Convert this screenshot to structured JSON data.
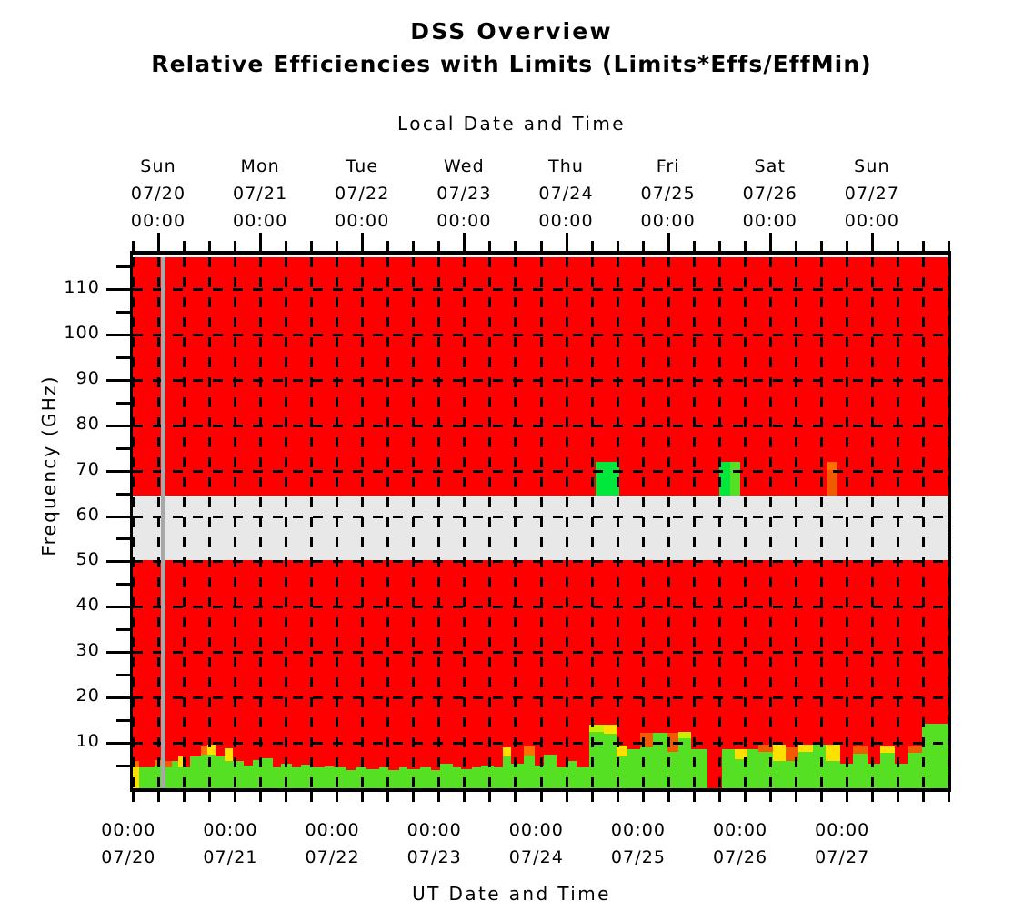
{
  "title": {
    "main": "DSS Overview",
    "sub": "Relative Efficiencies with Limits (Limits*Effs/EffMin)"
  },
  "axes": {
    "top_title": "Local Date and Time",
    "bottom_title": "UT Date and Time",
    "y_title": "Frequency (GHz)"
  },
  "chart_data": {
    "type": "heatmap",
    "title": "DSS Overview — Relative Efficiencies with Limits (Limits*Effs/EffMin)",
    "xlabel": "Local Date and Time",
    "xlabel_secondary": "UT Date and Time",
    "ylabel": "Frequency (GHz)",
    "ylim": [
      0,
      117
    ],
    "ytick_major": [
      10,
      20,
      30,
      40,
      50,
      60,
      70,
      80,
      90,
      100,
      110
    ],
    "ytick_minor_step": 5,
    "grid": "dashed black, horizontal every 10 GHz, vertical every 6 hours",
    "xlim_days": 8,
    "x_minor_step_hours": 6,
    "top_ticks": [
      {
        "weekday": "Sun",
        "date": "07/20",
        "time": "00:00"
      },
      {
        "weekday": "Mon",
        "date": "07/21",
        "time": "00:00"
      },
      {
        "weekday": "Tue",
        "date": "07/22",
        "time": "00:00"
      },
      {
        "weekday": "Wed",
        "date": "07/23",
        "time": "00:00"
      },
      {
        "weekday": "Thu",
        "date": "07/24",
        "time": "00:00"
      },
      {
        "weekday": "Fri",
        "date": "07/25",
        "time": "00:00"
      },
      {
        "weekday": "Sat",
        "date": "07/26",
        "time": "00:00"
      },
      {
        "weekday": "Sun",
        "date": "07/27",
        "time": "00:00"
      }
    ],
    "bottom_ticks": [
      {
        "time": "00:00",
        "date": "07/20"
      },
      {
        "time": "00:00",
        "date": "07/21"
      },
      {
        "time": "00:00",
        "date": "07/22"
      },
      {
        "time": "00:00",
        "date": "07/23"
      },
      {
        "time": "00:00",
        "date": "07/24"
      },
      {
        "time": "00:00",
        "date": "07/25"
      },
      {
        "time": "00:00",
        "date": "07/26"
      },
      {
        "time": "00:00",
        "date": "07/27"
      }
    ],
    "colors": {
      "red": "#ff0000",
      "orange": "#ff7000",
      "dark_orange": "#f25a00",
      "yellow": "#ffe000",
      "yellow_green": "#c8f000",
      "green": "#55e024",
      "bright_green": "#00e83c",
      "masked_band": "#e8e8e8",
      "now_marker": "#a8a8a8",
      "background": "#ffffff",
      "axis": "#000000"
    },
    "masked_bands": [
      {
        "y_from": 50.2,
        "y_to": 64.6,
        "label": "opaque / no data band"
      }
    ],
    "now_marker": {
      "hours_from_start": 6.6,
      "label": "current time"
    },
    "blocks_upper": [
      {
        "x_hours_from_start": 109,
        "width_hours": 5.6,
        "y_from": 64.6,
        "y_to": 71.9,
        "color": "bright_green"
      },
      {
        "x_hours_from_start": 138,
        "width_hours": 4.8,
        "y_from": 64.6,
        "y_to": 71.9,
        "color": "bright_green"
      },
      {
        "x_hours_from_start": 140.6,
        "width_hours": 2.4,
        "y_from": 64.6,
        "y_to": 71.9,
        "color": "green"
      },
      {
        "x_hours_from_start": 163.5,
        "width_hours": 2.4,
        "y_from": 64.6,
        "y_to": 71.9,
        "color": "dark_orange"
      },
      {
        "x_hours_from_start": 163.5,
        "width_hours": 2.4,
        "y_from": 70.2,
        "y_to": 71.9,
        "color": "orange"
      }
    ],
    "lower_band_note": "Dense 1-hour resolution mosaic below ~14 GHz with green, yellow-green, yellow, orange and red cells; all area above is red except the masked 50-65 GHz band and three 65-72 GHz blocks.",
    "cells": [
      {
        "x": 0,
        "w": 7,
        "y0": 0.0,
        "y1": 4.6,
        "c": "yellow"
      },
      {
        "x": 0,
        "w": 7,
        "y0": 4.6,
        "y1": 6.0,
        "c": "orange"
      },
      {
        "x": 7,
        "w": 7,
        "y0": 0.0,
        "y1": 4.6,
        "c": "green"
      },
      {
        "x": 7,
        "w": 10,
        "y0": 4.6,
        "y1": 6.0,
        "c": "red"
      },
      {
        "x": 14,
        "w": 10,
        "y0": 0.0,
        "y1": 4.6,
        "c": "green"
      },
      {
        "x": 24,
        "w": 10,
        "y0": 0.0,
        "y1": 5.0,
        "c": "green"
      },
      {
        "x": 24,
        "w": 10,
        "y0": 5.0,
        "y1": 6.2,
        "c": "orange"
      },
      {
        "x": 34,
        "w": 9,
        "y0": 0.0,
        "y1": 4.6,
        "c": "green"
      },
      {
        "x": 34,
        "w": 9,
        "y0": 4.6,
        "y1": 6.0,
        "c": "dark_orange"
      },
      {
        "x": 43,
        "w": 7,
        "y0": 0.0,
        "y1": 6.0,
        "c": "green"
      },
      {
        "x": 50,
        "w": 5,
        "y0": 0.0,
        "y1": 4.6,
        "c": "green"
      },
      {
        "x": 50,
        "w": 5,
        "y0": 4.6,
        "y1": 7.0,
        "c": "yellow"
      },
      {
        "x": 55,
        "w": 8,
        "y0": 0.0,
        "y1": 4.6,
        "c": "green"
      },
      {
        "x": 63,
        "w": 12,
        "y0": 0.0,
        "y1": 7.0,
        "c": "green"
      },
      {
        "x": 75,
        "w": 7,
        "y0": 0.0,
        "y1": 7.4,
        "c": "green"
      },
      {
        "x": 75,
        "w": 7,
        "y0": 7.4,
        "y1": 9.2,
        "c": "orange"
      },
      {
        "x": 82,
        "w": 9,
        "y0": 0.0,
        "y1": 7.4,
        "c": "green"
      },
      {
        "x": 82,
        "w": 9,
        "y0": 7.4,
        "y1": 9.6,
        "c": "yellow"
      },
      {
        "x": 91,
        "w": 10,
        "y0": 0.0,
        "y1": 7.0,
        "c": "green"
      },
      {
        "x": 101,
        "w": 9,
        "y0": 0.0,
        "y1": 6.0,
        "c": "green"
      },
      {
        "x": 101,
        "w": 9,
        "y0": 6.0,
        "y1": 8.8,
        "c": "yellow"
      },
      {
        "x": 110,
        "w": 12,
        "y0": 0.0,
        "y1": 6.0,
        "c": "green"
      },
      {
        "x": 122,
        "w": 10,
        "y0": 0.0,
        "y1": 5.0,
        "c": "green"
      },
      {
        "x": 132,
        "w": 10,
        "y0": 0.0,
        "y1": 6.2,
        "c": "green"
      },
      {
        "x": 142,
        "w": 12,
        "y0": 0.0,
        "y1": 6.6,
        "c": "green"
      },
      {
        "x": 154,
        "w": 9,
        "y0": 0.0,
        "y1": 4.6,
        "c": "green"
      },
      {
        "x": 163,
        "w": 12,
        "y0": 0.0,
        "y1": 5.4,
        "c": "green"
      },
      {
        "x": 175,
        "w": 10,
        "y0": 0.0,
        "y1": 4.6,
        "c": "green"
      },
      {
        "x": 185,
        "w": 12,
        "y0": 0.0,
        "y1": 5.2,
        "c": "green"
      },
      {
        "x": 197,
        "w": 14,
        "y0": 0.0,
        "y1": 4.6,
        "c": "green"
      },
      {
        "x": 211,
        "w": 10,
        "y0": 0.0,
        "y1": 4.8,
        "c": "green"
      },
      {
        "x": 221,
        "w": 14,
        "y0": 0.0,
        "y1": 4.6,
        "c": "green"
      },
      {
        "x": 235,
        "w": 10,
        "y0": 0.0,
        "y1": 4.0,
        "c": "green"
      },
      {
        "x": 245,
        "w": 12,
        "y0": 0.0,
        "y1": 4.6,
        "c": "green"
      },
      {
        "x": 257,
        "w": 14,
        "y0": 0.0,
        "y1": 4.2,
        "c": "green"
      },
      {
        "x": 271,
        "w": 10,
        "y0": 0.0,
        "y1": 4.6,
        "c": "green"
      },
      {
        "x": 281,
        "w": 12,
        "y0": 0.0,
        "y1": 4.0,
        "c": "green"
      },
      {
        "x": 293,
        "w": 9,
        "y0": 0.0,
        "y1": 4.6,
        "c": "green"
      },
      {
        "x": 302,
        "w": 14,
        "y0": 0.0,
        "y1": 4.2,
        "c": "green"
      },
      {
        "x": 316,
        "w": 12,
        "y0": 0.0,
        "y1": 4.6,
        "c": "green"
      },
      {
        "x": 328,
        "w": 10,
        "y0": 0.0,
        "y1": 4.0,
        "c": "green"
      },
      {
        "x": 338,
        "w": 14,
        "y0": 0.0,
        "y1": 5.4,
        "c": "green"
      },
      {
        "x": 352,
        "w": 9,
        "y0": 0.0,
        "y1": 4.6,
        "c": "green"
      },
      {
        "x": 361,
        "w": 12,
        "y0": 0.0,
        "y1": 4.2,
        "c": "green"
      },
      {
        "x": 373,
        "w": 10,
        "y0": 0.0,
        "y1": 4.6,
        "c": "green"
      },
      {
        "x": 383,
        "w": 14,
        "y0": 0.0,
        "y1": 5.0,
        "c": "green"
      },
      {
        "x": 397,
        "w": 10,
        "y0": 0.0,
        "y1": 4.6,
        "c": "green"
      },
      {
        "x": 407,
        "w": 9,
        "y0": 0.0,
        "y1": 7.0,
        "c": "green"
      },
      {
        "x": 407,
        "w": 9,
        "y0": 7.0,
        "y1": 9.0,
        "c": "yellow"
      },
      {
        "x": 416,
        "w": 14,
        "y0": 0.0,
        "y1": 5.4,
        "c": "green"
      },
      {
        "x": 430,
        "w": 12,
        "y0": 0.0,
        "y1": 7.2,
        "c": "green"
      },
      {
        "x": 430,
        "w": 12,
        "y0": 7.2,
        "y1": 9.2,
        "c": "orange"
      },
      {
        "x": 442,
        "w": 10,
        "y0": 0.0,
        "y1": 5.0,
        "c": "green"
      },
      {
        "x": 452,
        "w": 14,
        "y0": 0.0,
        "y1": 7.4,
        "c": "green"
      },
      {
        "x": 466,
        "w": 12,
        "y0": 0.0,
        "y1": 4.6,
        "c": "green"
      },
      {
        "x": 478,
        "w": 10,
        "y0": 0.0,
        "y1": 6.0,
        "c": "green"
      },
      {
        "x": 488,
        "w": 14,
        "y0": 0.0,
        "y1": 4.6,
        "c": "green"
      },
      {
        "x": 502,
        "w": 16,
        "y0": 0.0,
        "y1": 12.4,
        "c": "green"
      },
      {
        "x": 502,
        "w": 16,
        "y0": 12.4,
        "y1": 14.0,
        "c": "yellow_green"
      },
      {
        "x": 518,
        "w": 14,
        "y0": 0.0,
        "y1": 12.0,
        "c": "green"
      },
      {
        "x": 518,
        "w": 14,
        "y0": 12.0,
        "y1": 14.0,
        "c": "yellow"
      },
      {
        "x": 532,
        "w": 12,
        "y0": 0.0,
        "y1": 7.0,
        "c": "green"
      },
      {
        "x": 532,
        "w": 12,
        "y0": 7.0,
        "y1": 9.4,
        "c": "yellow"
      },
      {
        "x": 544,
        "w": 14,
        "y0": 0.0,
        "y1": 8.6,
        "c": "green"
      },
      {
        "x": 558,
        "w": 14,
        "y0": 0.0,
        "y1": 12.2,
        "c": "green"
      },
      {
        "x": 558,
        "w": 14,
        "y0": 9.0,
        "y1": 12.2,
        "c": "dark_orange"
      },
      {
        "x": 572,
        "w": 16,
        "y0": 0.0,
        "y1": 12.2,
        "c": "green"
      },
      {
        "x": 588,
        "w": 12,
        "y0": 0.0,
        "y1": 8.0,
        "c": "green"
      },
      {
        "x": 588,
        "w": 12,
        "y0": 8.0,
        "y1": 12.2,
        "c": "dark_orange"
      },
      {
        "x": 600,
        "w": 14,
        "y0": 0.0,
        "y1": 12.4,
        "c": "green"
      },
      {
        "x": 600,
        "w": 14,
        "y0": 11.0,
        "y1": 12.4,
        "c": "yellow_green"
      },
      {
        "x": 614,
        "w": 18,
        "y0": 0.0,
        "y1": 8.6,
        "c": "green"
      },
      {
        "x": 632,
        "w": 16,
        "y0": 0.0,
        "y1": 9.0,
        "c": "red"
      },
      {
        "x": 648,
        "w": 14,
        "y0": 0.0,
        "y1": 8.6,
        "c": "green"
      },
      {
        "x": 662,
        "w": 14,
        "y0": 0.0,
        "y1": 6.4,
        "c": "green"
      },
      {
        "x": 662,
        "w": 14,
        "y0": 6.4,
        "y1": 8.6,
        "c": "yellow"
      },
      {
        "x": 676,
        "w": 12,
        "y0": 0.0,
        "y1": 8.6,
        "c": "green"
      },
      {
        "x": 688,
        "w": 16,
        "y0": 0.0,
        "y1": 9.6,
        "c": "green"
      },
      {
        "x": 688,
        "w": 16,
        "y0": 8.0,
        "y1": 9.6,
        "c": "dark_orange"
      },
      {
        "x": 704,
        "w": 14,
        "y0": 0.0,
        "y1": 6.0,
        "c": "green"
      },
      {
        "x": 704,
        "w": 14,
        "y0": 6.0,
        "y1": 9.6,
        "c": "yellow"
      },
      {
        "x": 718,
        "w": 14,
        "y0": 0.0,
        "y1": 6.0,
        "c": "green"
      },
      {
        "x": 718,
        "w": 14,
        "y0": 6.0,
        "y1": 9.0,
        "c": "dark_orange"
      },
      {
        "x": 732,
        "w": 16,
        "y0": 0.0,
        "y1": 9.6,
        "c": "green"
      },
      {
        "x": 732,
        "w": 16,
        "y0": 8.0,
        "y1": 9.6,
        "c": "yellow"
      },
      {
        "x": 748,
        "w": 14,
        "y0": 0.0,
        "y1": 9.6,
        "c": "green"
      },
      {
        "x": 762,
        "w": 16,
        "y0": 0.0,
        "y1": 6.0,
        "c": "green"
      },
      {
        "x": 762,
        "w": 16,
        "y0": 6.0,
        "y1": 9.6,
        "c": "yellow"
      },
      {
        "x": 778,
        "w": 14,
        "y0": 0.0,
        "y1": 5.4,
        "c": "green"
      },
      {
        "x": 792,
        "w": 16,
        "y0": 0.0,
        "y1": 7.6,
        "c": "green"
      },
      {
        "x": 792,
        "w": 16,
        "y0": 7.6,
        "y1": 9.2,
        "c": "dark_orange"
      },
      {
        "x": 808,
        "w": 14,
        "y0": 0.0,
        "y1": 5.4,
        "c": "green"
      },
      {
        "x": 822,
        "w": 16,
        "y0": 0.0,
        "y1": 7.8,
        "c": "green"
      },
      {
        "x": 822,
        "w": 16,
        "y0": 7.8,
        "y1": 9.2,
        "c": "yellow"
      },
      {
        "x": 838,
        "w": 14,
        "y0": 0.0,
        "y1": 5.4,
        "c": "green"
      },
      {
        "x": 852,
        "w": 16,
        "y0": 0.0,
        "y1": 7.8,
        "c": "green"
      },
      {
        "x": 852,
        "w": 16,
        "y0": 7.8,
        "y1": 9.2,
        "c": "dark_orange"
      },
      {
        "x": 868,
        "w": 29,
        "y0": 0.0,
        "y1": 14.2,
        "c": "green"
      }
    ]
  }
}
